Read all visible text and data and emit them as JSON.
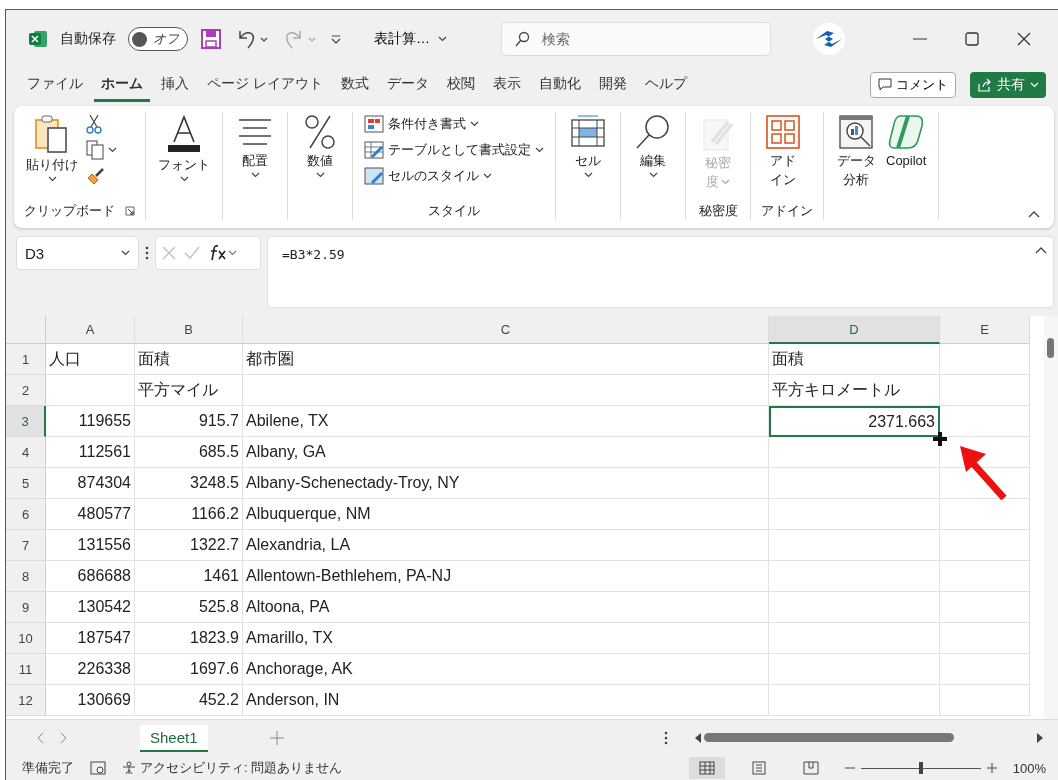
{
  "title_bar": {
    "autosave_label": "自動保存",
    "autosave_toggle": {
      "label": "オフ",
      "on": false
    },
    "file_name": "表計算…",
    "search": {
      "placeholder": "検索"
    }
  },
  "menu_tabs": [
    {
      "label": "ファイル",
      "selected": false
    },
    {
      "label": "ホーム",
      "selected": true
    },
    {
      "label": "挿入",
      "selected": false
    },
    {
      "label": "ページ レイアウト",
      "selected": false
    },
    {
      "label": "数式",
      "selected": false
    },
    {
      "label": "データ",
      "selected": false
    },
    {
      "label": "校閲",
      "selected": false
    },
    {
      "label": "表示",
      "selected": false
    },
    {
      "label": "自動化",
      "selected": false
    },
    {
      "label": "開発",
      "selected": false
    },
    {
      "label": "ヘルプ",
      "selected": false
    }
  ],
  "comment_button": "コメント",
  "share_button": "共有",
  "ribbon": {
    "groups": [
      {
        "label": "クリップボード",
        "launcher": true,
        "commands": [
          {
            "kind": "paste",
            "lines": [
              "貼り付け"
            ],
            "dropdown": true
          }
        ]
      },
      {
        "commands": [
          {
            "kind": "large",
            "lines": [
              "フォント"
            ],
            "dropdown": true,
            "disabled": false
          }
        ]
      },
      {
        "commands": [
          {
            "kind": "large",
            "lines": [
              "配置"
            ],
            "dropdown": true,
            "disabled": false
          }
        ]
      },
      {
        "commands": [
          {
            "kind": "large",
            "lines": [
              "数値"
            ],
            "dropdown": true,
            "disabled": false
          }
        ]
      },
      {
        "label": "スタイル",
        "commands": [
          {
            "kind": "list",
            "items": [
              "条件付き書式",
              "テーブルとして書式設定",
              "セルのスタイル"
            ]
          }
        ]
      },
      {
        "commands": [
          {
            "kind": "large",
            "lines": [
              "セル"
            ],
            "dropdown": true,
            "disabled": false
          }
        ]
      },
      {
        "commands": [
          {
            "kind": "large",
            "lines": [
              "編集"
            ],
            "dropdown": true,
            "disabled": false
          }
        ]
      },
      {
        "label": "秘密度",
        "commands": [
          {
            "kind": "large",
            "lines": [
              "秘密",
              "度"
            ],
            "dropdown": true,
            "disabled": true
          }
        ]
      },
      {
        "label": "アドイン",
        "commands": [
          {
            "kind": "large",
            "lines": [
              "アド",
              "イン"
            ],
            "dropdown": false,
            "disabled": false
          }
        ]
      },
      {
        "commands": [
          {
            "kind": "large",
            "lines": [
              "データ",
              "分析"
            ],
            "dropdown": false,
            "disabled": false
          },
          {
            "kind": "large",
            "lines": [
              "Copilot"
            ],
            "dropdown": false,
            "disabled": false
          }
        ]
      }
    ]
  },
  "formula_bar": {
    "name_box": "D3",
    "formula": "=B3*2.59"
  },
  "columns": [
    {
      "label": "A",
      "selected": false
    },
    {
      "label": "B",
      "selected": false
    },
    {
      "label": "C",
      "selected": false
    },
    {
      "label": "D",
      "selected": true
    },
    {
      "label": "E",
      "selected": false
    }
  ],
  "rows": [
    {
      "number": "1",
      "kind": "text",
      "selected": false,
      "cells": {
        "A": "人口",
        "B": "面積",
        "C": "都市圏",
        "D": "面積"
      }
    },
    {
      "number": "2",
      "kind": "text",
      "selected": false,
      "cells": {
        "B": "平方マイル",
        "D": "平方キロメートル"
      }
    },
    {
      "number": "3",
      "kind": "data",
      "selected": true,
      "cells": {
        "A": "119655",
        "B": "915.7",
        "C": "Abilene, TX",
        "D": "2371.663"
      }
    },
    {
      "number": "4",
      "kind": "data",
      "selected": false,
      "cells": {
        "A": "112561",
        "B": "685.5",
        "C": "Albany, GA"
      }
    },
    {
      "number": "5",
      "kind": "data",
      "selected": false,
      "cells": {
        "A": "874304",
        "B": "3248.5",
        "C": "Albany-Schenectady-Troy, NY"
      }
    },
    {
      "number": "6",
      "kind": "data",
      "selected": false,
      "cells": {
        "A": "480577",
        "B": "1166.2",
        "C": "Albuquerque, NM"
      }
    },
    {
      "number": "7",
      "kind": "data",
      "selected": false,
      "cells": {
        "A": "131556",
        "B": "1322.7",
        "C": "Alexandria, LA"
      }
    },
    {
      "number": "8",
      "kind": "data",
      "selected": false,
      "cells": {
        "A": "686688",
        "B": "1461",
        "C": "Allentown-Bethlehem, PA-NJ"
      }
    },
    {
      "number": "9",
      "kind": "data",
      "selected": false,
      "cells": {
        "A": "130542",
        "B": "525.8",
        "C": "Altoona, PA"
      }
    },
    {
      "number": "10",
      "kind": "data",
      "selected": false,
      "cells": {
        "A": "187547",
        "B": "1823.9",
        "C": "Amarillo, TX"
      }
    },
    {
      "number": "11",
      "kind": "data",
      "selected": false,
      "cells": {
        "A": "226338",
        "B": "1697.6",
        "C": "Anchorage, AK"
      }
    },
    {
      "number": "12",
      "kind": "data",
      "selected": false,
      "cells": {
        "A": "130669",
        "B": "452.2",
        "C": "Anderson, IN"
      }
    }
  ],
  "sheet_tabs": [
    {
      "label": "Sheet1",
      "selected": true
    }
  ],
  "status_bar": {
    "status": "準備完了",
    "accessibility": "アクセシビリティ: 問題ありません",
    "zoom": {
      "level": 0.5,
      "reading": "100%"
    }
  }
}
